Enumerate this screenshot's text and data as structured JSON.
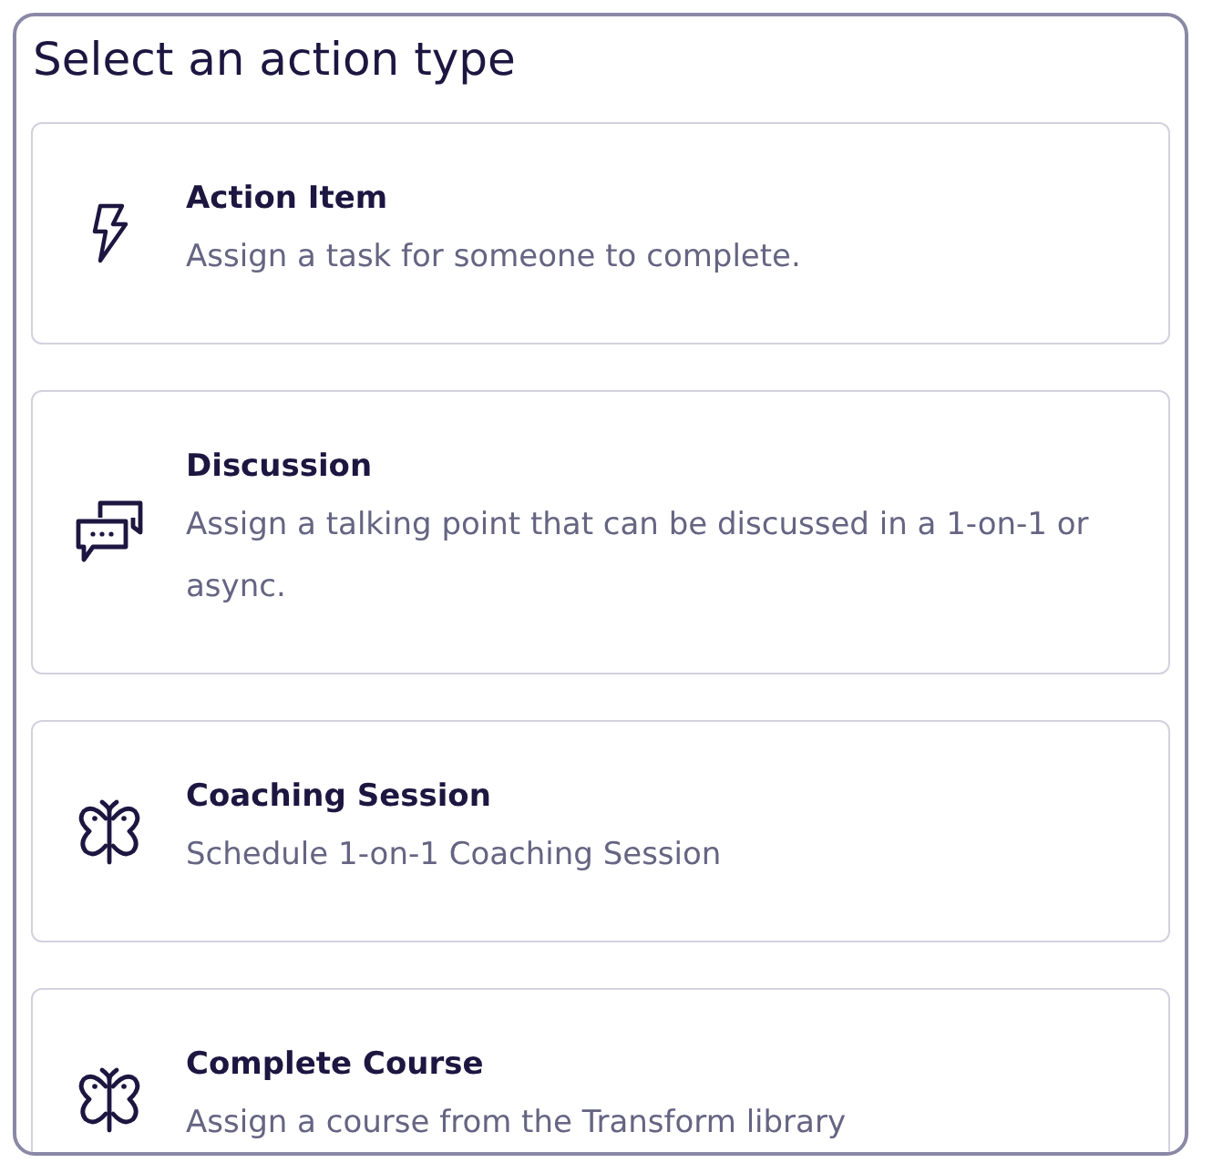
{
  "title": "Select an action type",
  "options": [
    {
      "kind": "bolt",
      "label": "Action Item",
      "description": "Assign a task for someone to complete."
    },
    {
      "kind": "chat",
      "label": "Discussion",
      "description": "Assign a talking point that can be discussed in a 1-on-1 or async."
    },
    {
      "kind": "butterfly",
      "label": "Coaching Session",
      "description": "Schedule 1-on-1 Coaching Session"
    },
    {
      "kind": "butterfly",
      "label": "Complete Course",
      "description": "Assign a course from the Transform library"
    }
  ]
}
